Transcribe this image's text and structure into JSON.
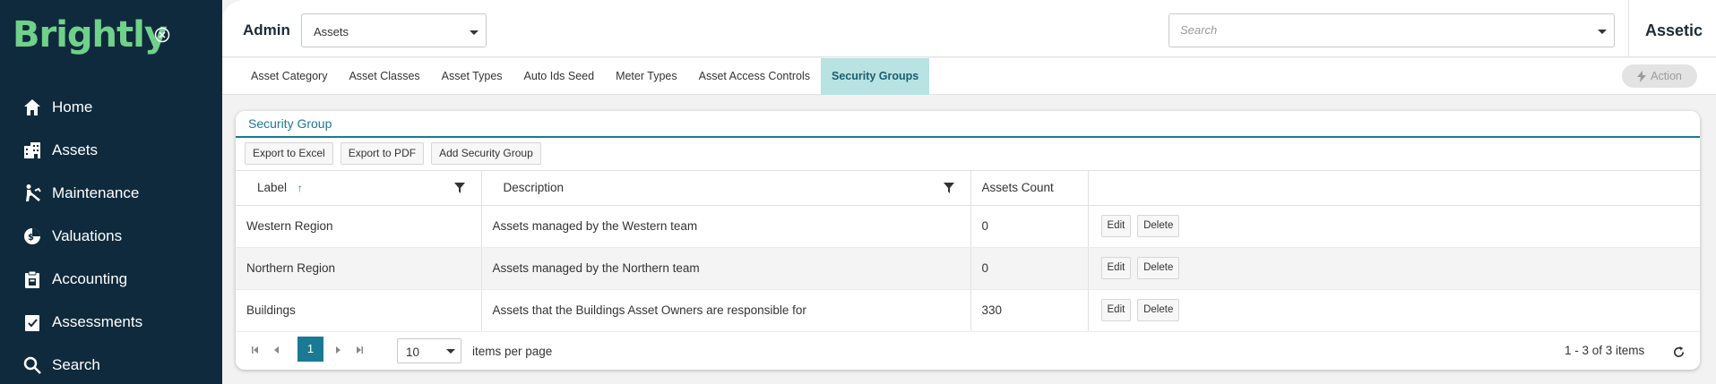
{
  "sidebar": {
    "logo": "Brightly",
    "items": [
      {
        "label": "Home",
        "icon": "home-icon"
      },
      {
        "label": "Assets",
        "icon": "building-icon"
      },
      {
        "label": "Maintenance",
        "icon": "maintenance-icon"
      },
      {
        "label": "Valuations",
        "icon": "valuation-icon"
      },
      {
        "label": "Accounting",
        "icon": "clipboard-icon"
      },
      {
        "label": "Assessments",
        "icon": "assessment-icon"
      },
      {
        "label": "Search",
        "icon": "search-icon"
      }
    ]
  },
  "header": {
    "admin_label": "Admin",
    "module_value": "Assets",
    "search_placeholder": "Search",
    "brand": "Assetic"
  },
  "tabs": [
    {
      "label": "Asset Category",
      "active": false
    },
    {
      "label": "Asset Classes",
      "active": false
    },
    {
      "label": "Asset Types",
      "active": false
    },
    {
      "label": "Auto Ids Seed",
      "active": false
    },
    {
      "label": "Meter Types",
      "active": false
    },
    {
      "label": "Asset Access Controls",
      "active": false
    },
    {
      "label": "Security Groups",
      "active": true
    }
  ],
  "action_label": "Action",
  "panel": {
    "title": "Security Group",
    "toolbar": {
      "export_excel": "Export to Excel",
      "export_pdf": "Export to PDF",
      "add": "Add Security Group"
    },
    "columns": {
      "label": "Label",
      "description": "Description",
      "count": "Assets Count"
    },
    "rows": [
      {
        "label": "Western Region",
        "description": "Assets managed by the Western team",
        "count": "0",
        "edit": "Edit",
        "delete": "Delete"
      },
      {
        "label": "Northern Region",
        "description": "Assets managed by the Northern team",
        "count": "0",
        "edit": "Edit",
        "delete": "Delete"
      },
      {
        "label": "Buildings",
        "description": "Assets that the Buildings Asset Owners are responsible for",
        "count": "330",
        "edit": "Edit",
        "delete": "Delete"
      }
    ],
    "pager": {
      "current_page": "1",
      "per_page": "10",
      "per_page_label": "items per page",
      "info": "1 - 3 of 3 items"
    }
  },
  "colors": {
    "sidebar_bg": "#0f2a3c",
    "logo_green": "#6fd18a",
    "accent_teal": "#1a7a93",
    "active_tab_bg": "#b9e2e3"
  }
}
